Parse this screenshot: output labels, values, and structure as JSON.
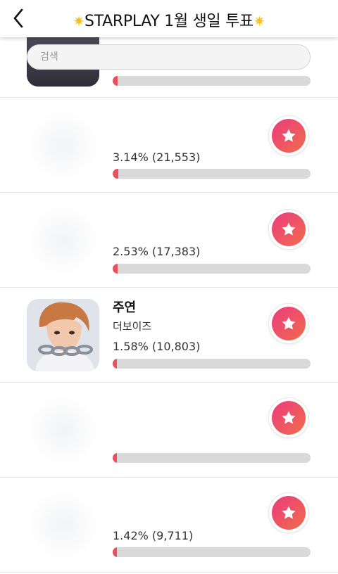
{
  "header": {
    "title": "STARPLAY 1월 생일 투표",
    "back_icon": "chevron-left-icon",
    "title_icon": "sparkle-icon"
  },
  "search": {
    "placeholder": "검색"
  },
  "accent": {
    "bar_fill": "#e8505b",
    "bar_track": "#d9d9d9",
    "vote_gradient": [
      "#ec3b7f",
      "#f06c4a"
    ]
  },
  "candidates": [
    {
      "name": "",
      "group": "",
      "stat": "",
      "percent": 0.3
    },
    {
      "name": "",
      "group": "",
      "stat": "3.14% (21,553)",
      "percent": 3.14
    },
    {
      "name": "",
      "group": "",
      "stat": "2.53% (17,383)",
      "percent": 2.53
    },
    {
      "name": "주연",
      "group": "더보이즈",
      "stat": "1.58% (10,803)",
      "percent": 1.58
    },
    {
      "name": "",
      "group": "",
      "stat": "",
      "percent": 1.45
    },
    {
      "name": "",
      "group": "",
      "stat": "1.42% (9,711)",
      "percent": 1.42
    }
  ]
}
